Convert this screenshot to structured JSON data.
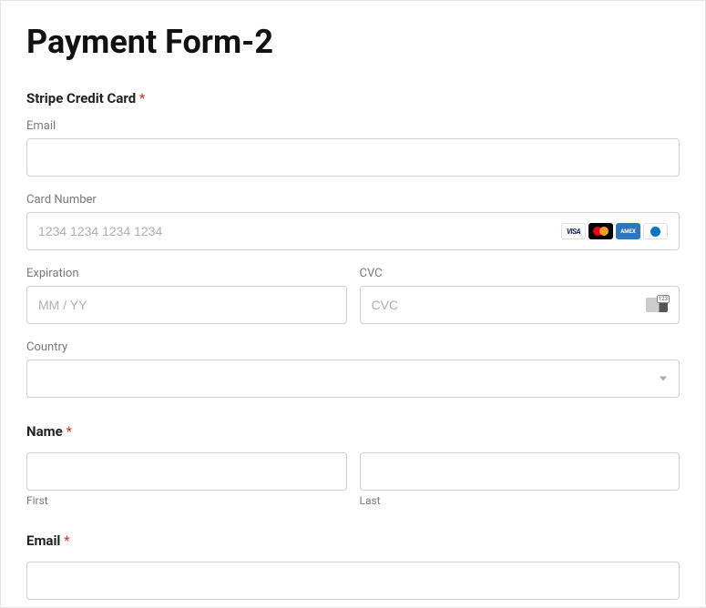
{
  "title": "Payment Form-2",
  "requiredMark": "*",
  "stripe": {
    "sectionLabel": "Stripe Credit Card",
    "email": {
      "label": "Email"
    },
    "cardNumber": {
      "label": "Card Number",
      "placeholder": "1234 1234 1234 1234"
    },
    "expiration": {
      "label": "Expiration",
      "placeholder": "MM / YY"
    },
    "cvc": {
      "label": "CVC",
      "placeholder": "CVC"
    },
    "country": {
      "label": "Country"
    },
    "brands": {
      "visa": "VISA",
      "amex": "AMEX"
    }
  },
  "name": {
    "label": "Name",
    "first": "First",
    "last": "Last"
  },
  "email": {
    "label": "Email"
  }
}
